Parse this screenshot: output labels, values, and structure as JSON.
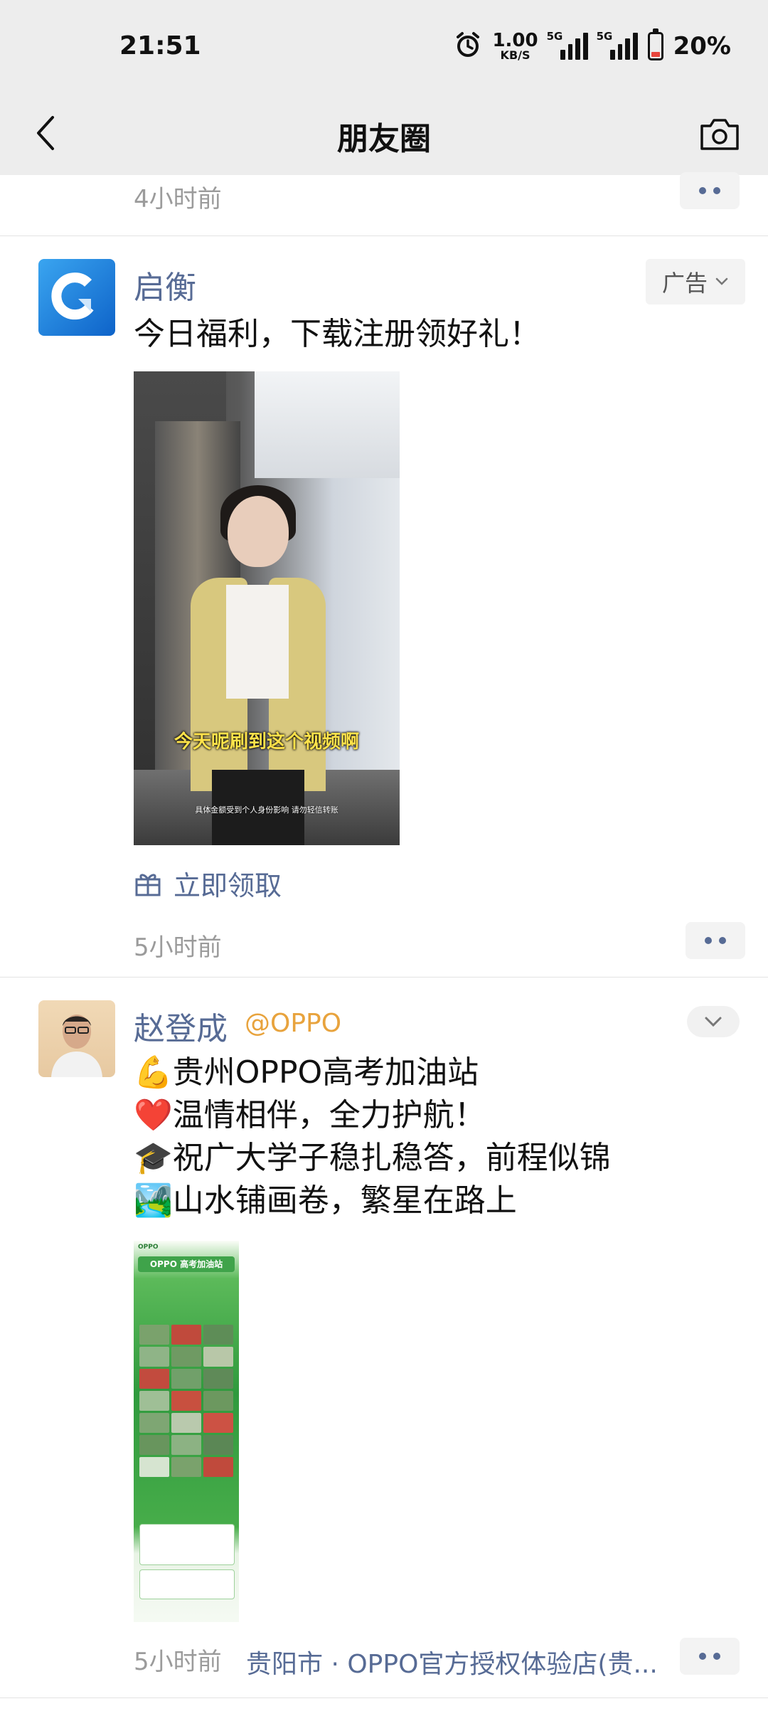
{
  "status_bar": {
    "time": "21:51",
    "net_speed_value": "1.00",
    "net_speed_unit": "KB/S",
    "sim1_label": "5G",
    "sim2_label": "5G",
    "battery_level": 0.2,
    "battery_text": "20%"
  },
  "nav": {
    "title": "朋友圈"
  },
  "previous_post": {
    "time": "4小时前"
  },
  "ad_post": {
    "name": "启衡",
    "badge": "广告",
    "text": "今日福利，下载注册领好礼！",
    "video_subtitle": "今天呢刷到这个视频啊",
    "video_caption": "具体金额受到个人身份影响 请勿轻信转账",
    "action_label": "立即领取",
    "time": "5小时前"
  },
  "user_post": {
    "name": "赵登成",
    "handle": "@OPPO",
    "lines": [
      "💪贵州OPPO高考加油站",
      "❤️温情相伴，全力护航！",
      "🎓祝广大学子稳扎稳答，前程似锦",
      "🏞️山水铺画卷，繁星在路上"
    ],
    "poster_brand": "OPPO",
    "poster_title": "OPPO 高考加油站",
    "time": "5小时前",
    "location": "贵阳市 · OPPO官方授权体验店(贵..."
  },
  "colors": {
    "link_blue": "#576b95",
    "handle_orange": "#e8a33d",
    "time_gray": "#9b9b9b",
    "topbar_bg": "#ededed"
  },
  "icons": {
    "back": "chevron-left-icon",
    "camera": "camera-icon",
    "alarm": "alarm-icon",
    "gift": "gift-icon",
    "more": "more-dots-icon",
    "collapse": "chevron-down-icon"
  }
}
